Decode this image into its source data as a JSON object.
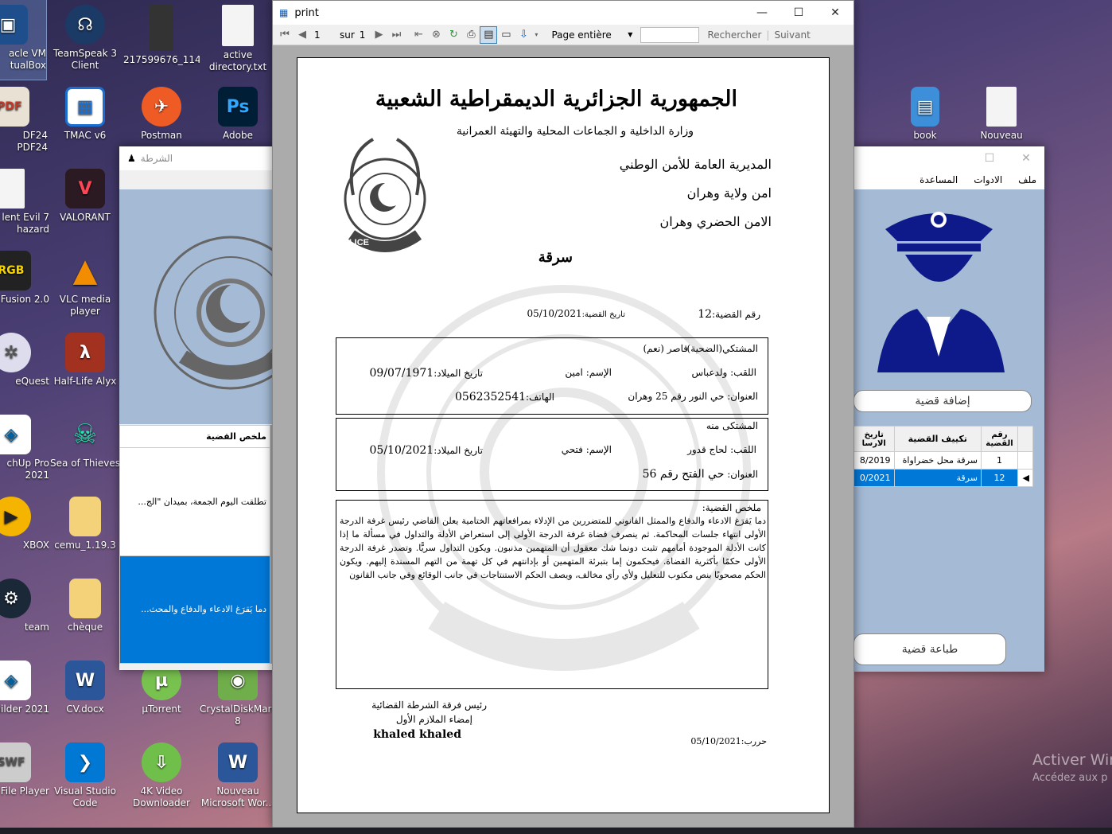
{
  "desktop": {
    "icons": [
      {
        "label": "acle VM\ntualBox"
      },
      {
        "label": "TeamSpeak 3\nClient"
      },
      {
        "label": "217599676_114..."
      },
      {
        "label": "active\ndirectory.txt"
      },
      {
        "label": "DF24\nPDF24"
      },
      {
        "label": "TMAC v6"
      },
      {
        "label": "Postman"
      },
      {
        "label": "Adobe"
      },
      {
        "label": "book"
      },
      {
        "label": "Nouveau"
      },
      {
        "label": "lent Evil 7\nhazard"
      },
      {
        "label": "VALORANT"
      },
      {
        "label": "Fusion 2.0"
      },
      {
        "label": "VLC media player"
      },
      {
        "label": "eQuest"
      },
      {
        "label": "Half-Life Alyx"
      },
      {
        "label": "chUp Pro\n2021"
      },
      {
        "label": "Sea of Thieves"
      },
      {
        "label": "XBOX"
      },
      {
        "label": "cemu_1.19.3"
      },
      {
        "label": "team"
      },
      {
        "label": "chèque"
      },
      {
        "label": "uilder 2021"
      },
      {
        "label": "CV.docx"
      },
      {
        "label": "µTorrent"
      },
      {
        "label": "CrystalDiskMark\n8"
      },
      {
        "label": "File Player"
      },
      {
        "label": "Visual Studio\nCode"
      },
      {
        "label": "4K Video\nDownloader"
      },
      {
        "label": "Nouveau\nMicrosoft Wor..."
      }
    ]
  },
  "police_left": {
    "title": "الشرطة",
    "grid_header": "ملخص القضية",
    "rows": [
      "تطلقت اليوم الجمعة، بميدان \"الج...",
      "دما يَقرَغ الادعاء والدفاع والمحث..."
    ]
  },
  "police_right": {
    "menu": [
      "ملف",
      "الادوات",
      "المساعدة"
    ],
    "add_button": "إضافة قضية",
    "print_button": "طباعة قضية",
    "headers": [
      "رقم القضية",
      "تكييف القضية",
      "تاريخ الارسا"
    ],
    "rows": [
      {
        "num": "1",
        "type": "سرقة محل خضراواة",
        "date": "8/2019"
      },
      {
        "num": "12",
        "type": "سرقة",
        "date": "0/2021"
      }
    ]
  },
  "print_window": {
    "title": "print",
    "page_current": "1",
    "page_of": "sur",
    "page_total": "1",
    "zoom": "Page entière",
    "search_label": "Rechercher",
    "next_label": "Suivant",
    "search_value": ""
  },
  "report": {
    "republic": "الجمهورية الجزائرية الديمقراطية الشعبية",
    "ministry": "وزارة الداخلية و الجماعات المحلية والتهيئة العمرانية",
    "directorate": "المديرية العامة للأمن الوطني",
    "wilaya": "امن ولاية وهران",
    "urban": "الامن الحضري وهران",
    "case_type": "سرقة",
    "case_num_label": "رقم القضية:",
    "case_num": "12",
    "case_date_label": "تاريخ القضية:",
    "case_date": "05/10/2021",
    "complainant": {
      "heading": "المشتكي(الضحية)",
      "minor": "قاصر (نعم)",
      "lastname_label": "اللقب:",
      "lastname": "ولدعباس",
      "firstname_label": "الإسم:",
      "firstname": "امين",
      "birth_label": "تاريخ الميلاد:",
      "birth": "09/07/1971",
      "address_label": "العنوان:",
      "address": "حي النور رقم 25 وهران",
      "phone_label": "الهاتف:",
      "phone": "0562352541"
    },
    "accused": {
      "heading": "المشتكى منه",
      "lastname_label": "اللقب:",
      "lastname": "لحاج قدور",
      "firstname_label": "الإسم:",
      "firstname": "فتحي",
      "birth_label": "تاريخ الميلاد:",
      "birth": "05/10/2021",
      "address_label": "العنوان:",
      "address": "حي الفتح رقم 56"
    },
    "summary_label": "ملخص القضية:",
    "summary": "دما يَقرَغ الادعاء والدفاع والممثل القانوني للمتضررين من الإدلاء بمرافعاتهم الختامية يعلن القاضي رئيس غرفة الدرجة الأولى انتهاء جلسات المحاكمة. ثم ينصرف قضاة غرفة الدرجة الأولى إلى استعراض الأدلة والتداول في مسألة ما إذا كانت الأدلة الموجودة أمامهم تثبت دونما شك معقول أن المتهمين مذنبون. ويكون التداول سريًّا. وتصدر غرفة الدرجة الأولى حكمًا بأكثرية القضاة. فيحكمون إما بتبرئة المتهمين أو بإدانتهم في كل تهمة من التهم المسندة إليهم. ويكون الحكم مصحوبًا بنص مكتوب للتعليل ولأي رأي مخالف، ويصف الحكم الاستنتاجات في جانب الوقائع وفي جانب القانون",
    "signature_title": "رئيس فرقة الشرطة القضائية",
    "signature_rank": "إمضاء الملازم الأول",
    "signature_name": "khaled khaled",
    "written_label": "حررب:",
    "written_date": "05/10/2021"
  },
  "watermark": {
    "line1": "Activer Win",
    "line2": "Accédez aux p"
  }
}
